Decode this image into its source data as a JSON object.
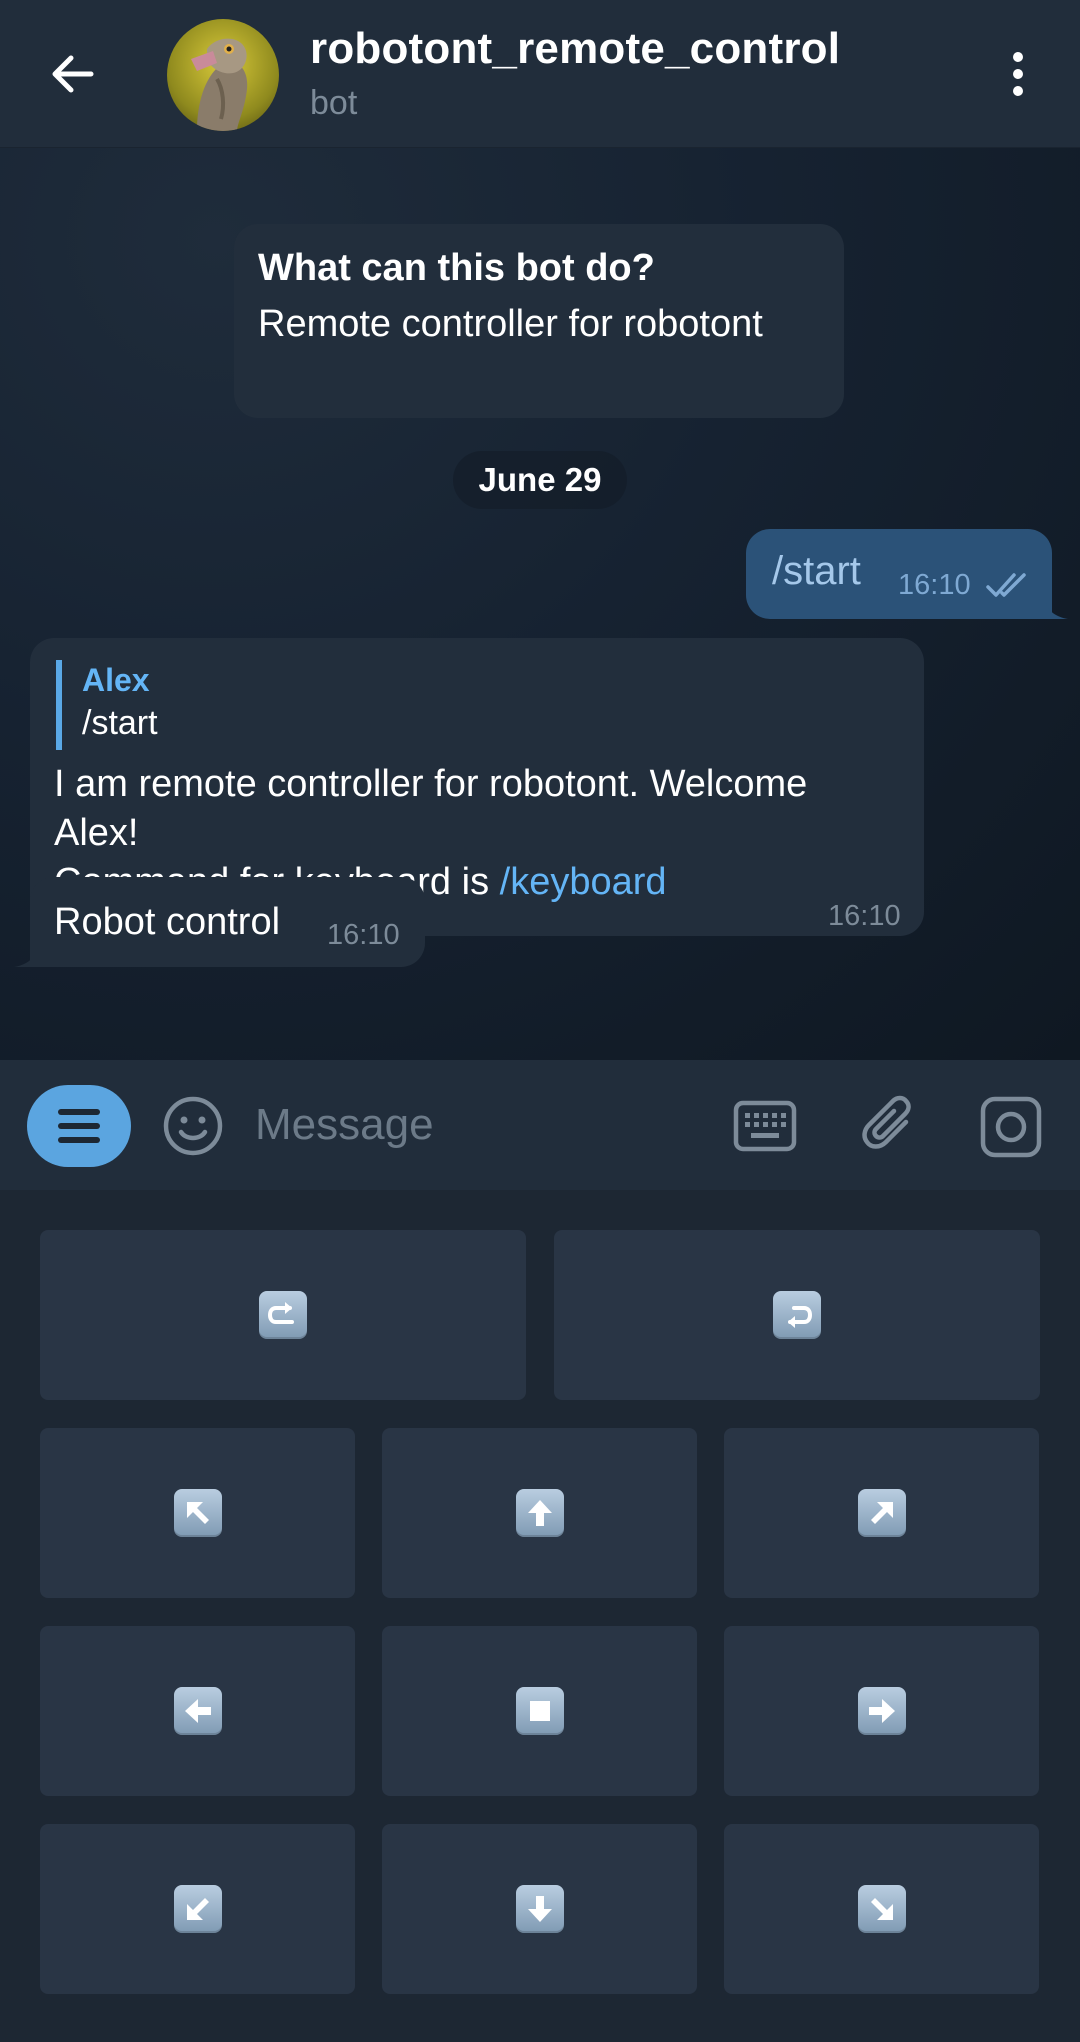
{
  "header": {
    "title": "robotont_remote_control",
    "subtitle": "bot"
  },
  "bot_info": {
    "title": "What can this bot do?",
    "text": "Remote controller for robotont"
  },
  "date_separator": "June 29",
  "messages": {
    "outgoing": {
      "text": "/start",
      "time": "16:10"
    },
    "incoming": {
      "reply_name": "Alex",
      "reply_text": "/start",
      "line1": "I am remote controller for robotont. Welcome Alex!",
      "line2_prefix": "Command for keyboard is ",
      "line2_link": "/keyboard",
      "time": "16:10"
    },
    "incoming2": {
      "text": "Robot control",
      "time": "16:10"
    }
  },
  "input": {
    "placeholder": "Message"
  },
  "keyboard": {
    "rows": [
      [
        {
          "icon": "rotate-right-icon"
        },
        {
          "icon": "rotate-left-icon"
        }
      ],
      [
        {
          "icon": "arrow-up-left-icon"
        },
        {
          "icon": "arrow-up-icon"
        },
        {
          "icon": "arrow-up-right-icon"
        }
      ],
      [
        {
          "icon": "arrow-left-icon"
        },
        {
          "icon": "stop-icon"
        },
        {
          "icon": "arrow-right-icon"
        }
      ],
      [
        {
          "icon": "arrow-down-left-icon"
        },
        {
          "icon": "arrow-down-icon"
        },
        {
          "icon": "arrow-down-right-icon"
        }
      ]
    ]
  },
  "colors": {
    "accent": "#5ba5e0",
    "link": "#64b5f6",
    "outgoing_bubble": "#2b5278",
    "incoming_bubble": "#222e3c"
  }
}
